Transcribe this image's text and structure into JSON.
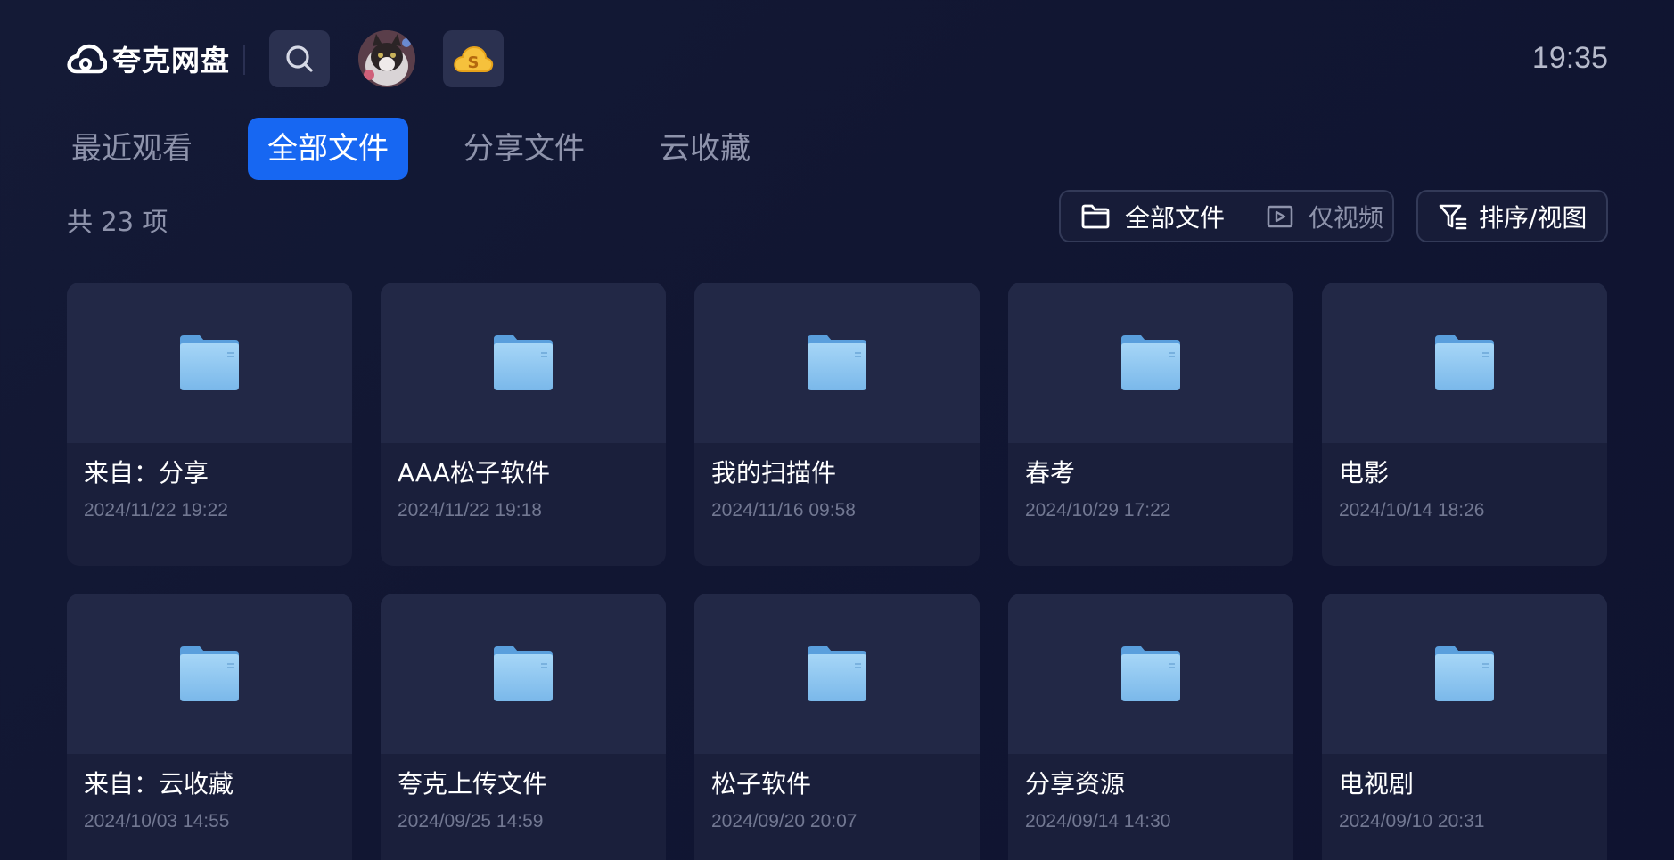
{
  "header": {
    "app_name": "夸克网盘",
    "clock": "19:35"
  },
  "tabs": [
    {
      "label": "最近观看",
      "active": false
    },
    {
      "label": "全部文件",
      "active": true
    },
    {
      "label": "分享文件",
      "active": false
    },
    {
      "label": "云收藏",
      "active": false
    }
  ],
  "toolbar": {
    "count_text": "共 23 项",
    "filter_all": "全部文件",
    "filter_video": "仅视频",
    "sort_view": "排序/视图"
  },
  "files": [
    {
      "name": "来自：分享",
      "date": "2024/11/22 19:22"
    },
    {
      "name": "AAA松子软件",
      "date": "2024/11/22 19:18"
    },
    {
      "name": "我的扫描件",
      "date": "2024/11/16 09:58"
    },
    {
      "name": "春考",
      "date": "2024/10/29 17:22"
    },
    {
      "name": "电影",
      "date": "2024/10/14 18:26"
    },
    {
      "name": "来自：云收藏",
      "date": "2024/10/03 14:55"
    },
    {
      "name": "夸克上传文件",
      "date": "2024/09/25 14:59"
    },
    {
      "name": "松子软件",
      "date": "2024/09/20 20:07"
    },
    {
      "name": "分享资源",
      "date": "2024/09/14 14:30"
    },
    {
      "name": "电视剧",
      "date": "2024/09/10 20:31"
    }
  ],
  "colors": {
    "accent": "#1767f2",
    "background": "#131834",
    "card": "#1a1f3b",
    "folder": "#8cc8f2"
  }
}
